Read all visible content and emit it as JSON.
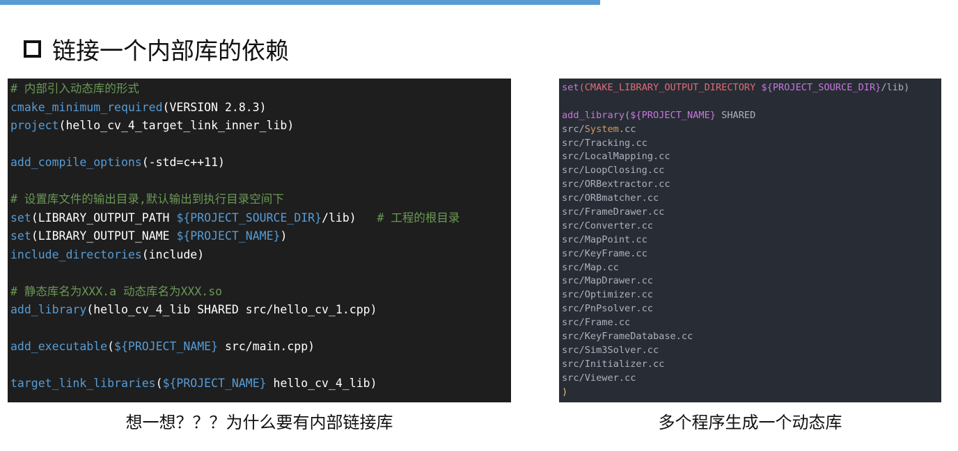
{
  "heading": {
    "text": "链接一个内部库的依赖"
  },
  "colors": {
    "top_bar": "#5b9bd5",
    "left_code_bg": "#1e1e1e",
    "right_code_bg": "#282c34"
  },
  "left_code": {
    "lines": [
      [
        {
          "t": "# 内部引入动态库的形式",
          "c": "c"
        }
      ],
      [
        {
          "t": "cmake_minimum_required",
          "c": "f"
        },
        {
          "t": "(VERSION 2.8.3)",
          "c": "w"
        }
      ],
      [
        {
          "t": "project",
          "c": "f"
        },
        {
          "t": "(hello_cv_4_target_link_inner_lib)",
          "c": "w"
        }
      ],
      [],
      [
        {
          "t": "add_compile_options",
          "c": "f"
        },
        {
          "t": "(-std=c++11)",
          "c": "w"
        }
      ],
      [],
      [
        {
          "t": "# 设置库文件的输出目录,默认输出到执行目录空间下",
          "c": "c"
        }
      ],
      [
        {
          "t": "set",
          "c": "f"
        },
        {
          "t": "(LIBRARY_OUTPUT_PATH ",
          "c": "w"
        },
        {
          "t": "${PROJECT_SOURCE_DIR}",
          "c": "v"
        },
        {
          "t": "/lib)   ",
          "c": "w"
        },
        {
          "t": "# 工程的根目录",
          "c": "c"
        }
      ],
      [
        {
          "t": "set",
          "c": "f"
        },
        {
          "t": "(LIBRARY_OUTPUT_NAME ",
          "c": "w"
        },
        {
          "t": "${PROJECT_NAME}",
          "c": "v"
        },
        {
          "t": ")",
          "c": "w"
        }
      ],
      [
        {
          "t": "include_directories",
          "c": "f"
        },
        {
          "t": "(include)",
          "c": "w"
        }
      ],
      [],
      [
        {
          "t": "# 静态库名为XXX.a 动态库名为XXX.so",
          "c": "c"
        }
      ],
      [
        {
          "t": "add_library",
          "c": "f"
        },
        {
          "t": "(hello_cv_4_lib SHARED src/hello_cv_1.cpp)",
          "c": "w"
        }
      ],
      [],
      [
        {
          "t": "add_executable",
          "c": "f"
        },
        {
          "t": "(",
          "c": "w"
        },
        {
          "t": "${PROJECT_NAME}",
          "c": "v"
        },
        {
          "t": " src/main.cpp)",
          "c": "w"
        }
      ],
      [],
      [
        {
          "t": "target_link_libraries",
          "c": "f"
        },
        {
          "t": "(",
          "c": "w"
        },
        {
          "t": "${PROJECT_NAME}",
          "c": "v"
        },
        {
          "t": " hello_cv_4_lib)",
          "c": "w"
        }
      ]
    ]
  },
  "right_code": {
    "lines": [
      [
        {
          "t": "set",
          "c": "k"
        },
        {
          "t": "(CMAKE_LIBRARY_OUTPUT_DIRECTORY ",
          "c": "r"
        },
        {
          "t": "${PROJECT_SOURCE_DIR}",
          "c": "v"
        },
        {
          "t": "/lib)",
          "c": "t"
        }
      ],
      [],
      [
        {
          "t": "add_library",
          "c": "k"
        },
        {
          "t": "(",
          "c": "t"
        },
        {
          "t": "${PROJECT_NAME}",
          "c": "v"
        },
        {
          "t": " SHARED",
          "c": "t"
        }
      ],
      [
        {
          "t": "src/",
          "c": "t"
        },
        {
          "t": "System",
          "c": "o"
        },
        {
          "t": ".cc",
          "c": "t"
        }
      ],
      [
        {
          "t": "src/Tracking.cc",
          "c": "t"
        }
      ],
      [
        {
          "t": "src/LocalMapping.cc",
          "c": "t"
        }
      ],
      [
        {
          "t": "src/LoopClosing.cc",
          "c": "t"
        }
      ],
      [
        {
          "t": "src/ORBextractor.cc",
          "c": "t"
        }
      ],
      [
        {
          "t": "src/ORBmatcher.cc",
          "c": "t"
        }
      ],
      [
        {
          "t": "src/FrameDrawer.cc",
          "c": "t"
        }
      ],
      [
        {
          "t": "src/Converter.cc",
          "c": "t"
        }
      ],
      [
        {
          "t": "src/MapPoint.cc",
          "c": "t"
        }
      ],
      [
        {
          "t": "src/KeyFrame.cc",
          "c": "t"
        }
      ],
      [
        {
          "t": "src/Map.cc",
          "c": "t"
        }
      ],
      [
        {
          "t": "src/MapDrawer.cc",
          "c": "t"
        }
      ],
      [
        {
          "t": "src/Optimizer.cc",
          "c": "t"
        }
      ],
      [
        {
          "t": "src/PnPsolver.cc",
          "c": "t"
        }
      ],
      [
        {
          "t": "src/Frame.cc",
          "c": "t"
        }
      ],
      [
        {
          "t": "src/KeyFrameDatabase.cc",
          "c": "t"
        }
      ],
      [
        {
          "t": "src/Sim3Solver.cc",
          "c": "t"
        }
      ],
      [
        {
          "t": "src/Initializer.cc",
          "c": "t"
        }
      ],
      [
        {
          "t": "src/Viewer.cc",
          "c": "t"
        }
      ],
      [
        {
          "t": ")",
          "c": "y"
        }
      ]
    ]
  },
  "captions": {
    "left": "想一想？？？为什么要有内部链接库",
    "right": "多个程序生成一个动态库"
  }
}
